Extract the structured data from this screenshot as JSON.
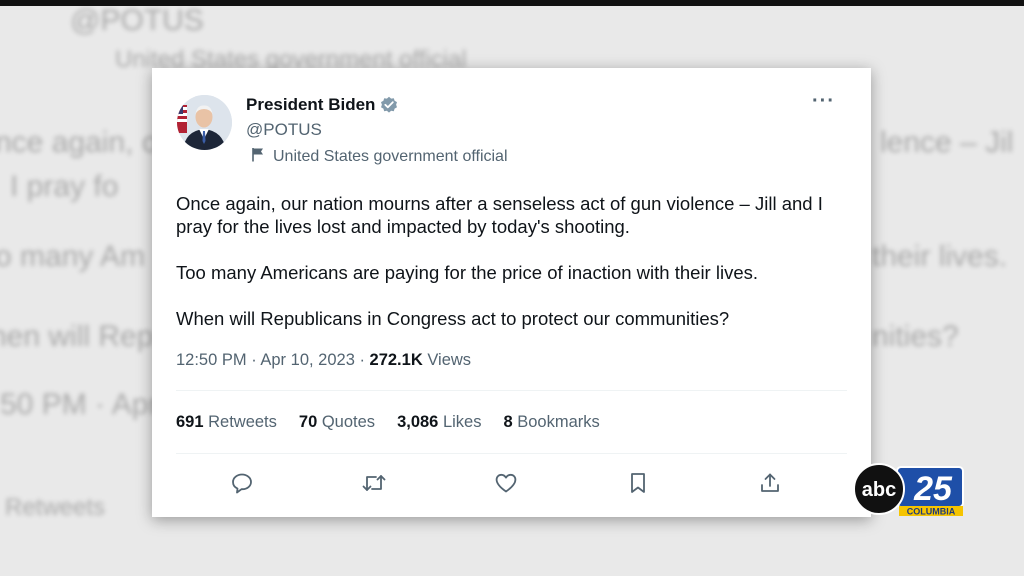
{
  "background": {
    "handle": "@POTUS",
    "affiliation": "United States government official",
    "line1": "nce again, o",
    "line1_right": "lence – Jil",
    "line2": "I pray fo",
    "line3": "o many Am",
    "line3_right": "their lives.",
    "line4": "hen will Rep",
    "line4_right": "nities?",
    "line5": "50 PM · Apr",
    "line6": "Retweets"
  },
  "tweet": {
    "author_name": "President Biden",
    "handle": "@POTUS",
    "affiliation": "United States government official",
    "paragraphs": [
      "Once again, our nation mourns after a senseless act of gun violence – Jill and I pray for the lives lost and impacted by today's shooting.",
      "Too many Americans are paying for the price of inaction with their lives.",
      "When will Republicans in Congress act to protect our communities?"
    ],
    "time_date": "12:50 PM · Apr 10, 2023 · ",
    "views_count": "272.1K",
    "views_label": " Views",
    "stats": [
      {
        "count": "691",
        "label": " Retweets"
      },
      {
        "count": "70",
        "label": " Quotes"
      },
      {
        "count": "3,086",
        "label": " Likes"
      },
      {
        "count": "8",
        "label": " Bookmarks"
      }
    ],
    "more_label": "···",
    "actions": [
      "reply-icon",
      "retweet-icon",
      "like-icon",
      "bookmark-icon",
      "share-icon"
    ]
  },
  "logo": {
    "brand": "abc",
    "channel": "25",
    "city": "COLUMBIA"
  },
  "colors": {
    "verified": "#829aab",
    "secondary_text": "#536471",
    "logo_blue": "#1e4fa8",
    "logo_yellow": "#f5c400"
  }
}
